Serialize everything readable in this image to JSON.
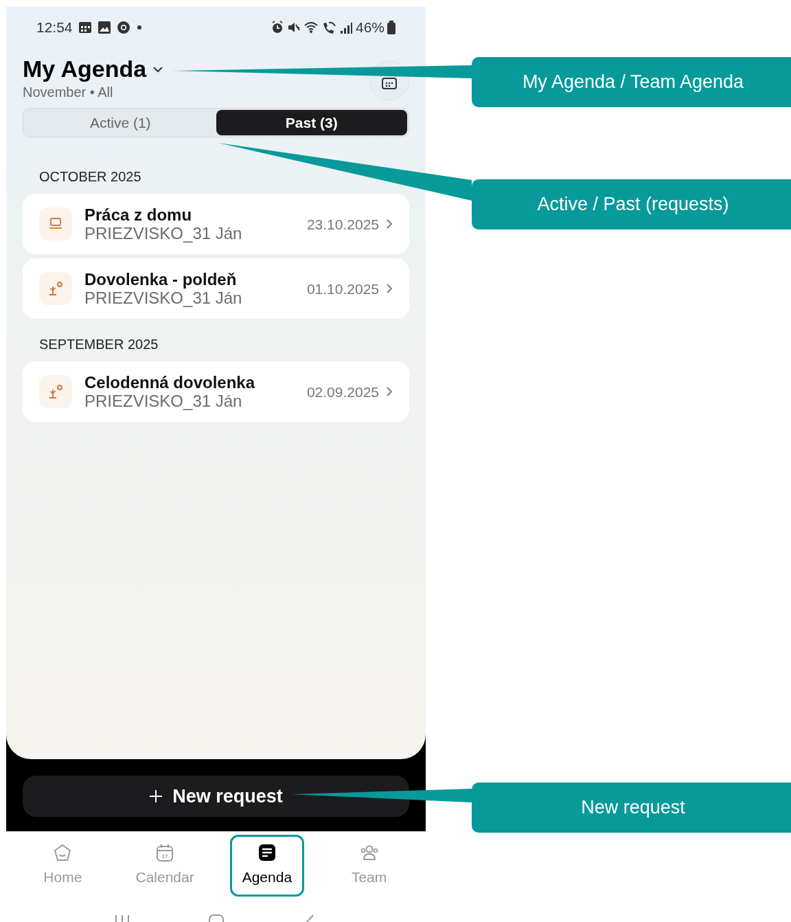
{
  "status_bar": {
    "time": "12:54",
    "battery": "46%"
  },
  "header": {
    "title": "My Agenda",
    "subtitle": "November • All"
  },
  "tabs": [
    {
      "label": "Active",
      "count": "(1)",
      "selected": false
    },
    {
      "label": "Past",
      "count": "(3)",
      "selected": true
    }
  ],
  "sections": [
    {
      "heading": "OCTOBER 2025",
      "requests": [
        {
          "kind": "remote",
          "title": "Práca z domu",
          "person": "PRIEZVISKO_31 Ján",
          "date": "23.10.2025"
        },
        {
          "kind": "vacation",
          "title": "Dovolenka - poldeň",
          "person": "PRIEZVISKO_31 Ján",
          "date": "01.10.2025"
        }
      ]
    },
    {
      "heading": "SEPTEMBER 2025",
      "requests": [
        {
          "kind": "vacation",
          "title": "Celodenná dovolenka",
          "person": "PRIEZVISKO_31 Ján",
          "date": "02.09.2025"
        }
      ]
    }
  ],
  "new_request_button": {
    "label": "New request"
  },
  "bottom_nav": [
    {
      "kind": "home",
      "label": "Home",
      "selected": false,
      "framed": false
    },
    {
      "kind": "calendar",
      "label": "Calendar",
      "icon_text": "17",
      "selected": false,
      "framed": false
    },
    {
      "kind": "agenda",
      "label": "Agenda",
      "selected": true,
      "framed": true
    },
    {
      "kind": "team",
      "label": "Team",
      "selected": false,
      "framed": false
    }
  ],
  "callouts": [
    {
      "text": "My Agenda / Team Agenda"
    },
    {
      "text": "Active / Past (requests)"
    },
    {
      "text": "New request"
    }
  ]
}
